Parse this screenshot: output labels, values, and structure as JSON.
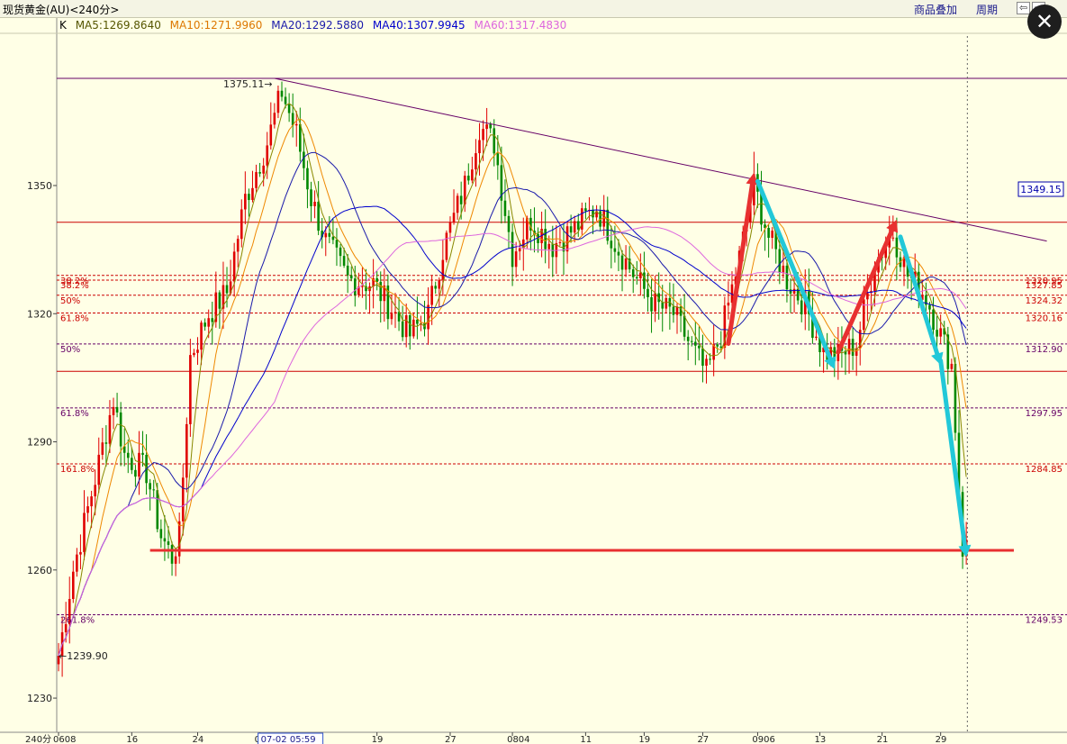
{
  "titlebar": {
    "title": "现货黄金(AU)<240分>",
    "overlay_label": "商品叠加",
    "period_label": "周期",
    "nav_left": "⇦",
    "nav_right": "⇨"
  },
  "close_glyph": "✕",
  "legend": {
    "k": "K",
    "ma5": "MA5:1269.8640",
    "ma10": "MA10:1271.9960",
    "ma20": "MA20:1292.5880",
    "ma40": "MA40:1307.9945",
    "ma60": "MA60:1317.4830"
  },
  "colors": {
    "background": "#ffffe6",
    "up": "#e00000",
    "down": "#008800",
    "ma5": "#888800",
    "ma10": "#ee8800",
    "ma20": "#1a1aaa",
    "ma40": "#0000cc",
    "ma60": "#dd66dd",
    "trendline": "#660066",
    "red_arrow": "#e83030",
    "cyan_arrow": "#22c8d8",
    "price_tag": "#0000aa"
  },
  "chart_data": {
    "type": "candlestick",
    "title": "",
    "ylim": [
      1222,
      1385
    ],
    "y_ticks": [
      1230,
      1260,
      1290,
      1320,
      1350
    ],
    "x_ticks": [
      "0608",
      "16",
      "24",
      "07",
      "19",
      "27",
      "0804",
      "11",
      "19",
      "27",
      "0906",
      "13",
      "21",
      "29"
    ],
    "interval_label": "240分",
    "cursor_time": "07-02 05:59",
    "current_price": "1349.15",
    "max_label": "1375.11",
    "min_label": "1239.90",
    "anchors": [
      [
        0,
        1240
      ],
      [
        4,
        1260
      ],
      [
        11,
        1285
      ],
      [
        15,
        1300
      ],
      [
        18,
        1287
      ],
      [
        24,
        1283
      ],
      [
        28,
        1268
      ],
      [
        31,
        1263
      ],
      [
        33,
        1268
      ],
      [
        36,
        1310
      ],
      [
        41,
        1320
      ],
      [
        46,
        1325
      ],
      [
        51,
        1347
      ],
      [
        57,
        1360
      ],
      [
        61,
        1372
      ],
      [
        65,
        1362
      ],
      [
        69,
        1347
      ],
      [
        73,
        1337
      ],
      [
        79,
        1328
      ],
      [
        86,
        1327
      ],
      [
        91,
        1321
      ],
      [
        96,
        1315
      ],
      [
        101,
        1320
      ],
      [
        105,
        1335
      ],
      [
        111,
        1350
      ],
      [
        115,
        1364
      ],
      [
        119,
        1360
      ],
      [
        124,
        1334
      ],
      [
        129,
        1342
      ],
      [
        135,
        1336
      ],
      [
        141,
        1340
      ],
      [
        147,
        1345
      ],
      [
        153,
        1335
      ],
      [
        158,
        1328
      ],
      [
        163,
        1322
      ],
      [
        168,
        1320
      ],
      [
        173,
        1312
      ],
      [
        177,
        1306
      ],
      [
        181,
        1315
      ],
      [
        186,
        1333
      ],
      [
        190,
        1350
      ],
      [
        194,
        1338
      ],
      [
        199,
        1328
      ],
      [
        204,
        1322
      ],
      [
        209,
        1311
      ],
      [
        213,
        1310
      ],
      [
        218,
        1313
      ],
      [
        223,
        1332
      ],
      [
        228,
        1339
      ],
      [
        232,
        1329
      ],
      [
        237,
        1324
      ],
      [
        241,
        1315
      ],
      [
        244,
        1308
      ],
      [
        247,
        1265
      ],
      [
        249,
        1266
      ]
    ],
    "moving_averages": [
      {
        "name": "MA5",
        "period": 5
      },
      {
        "name": "MA10",
        "period": 10
      },
      {
        "name": "MA20",
        "period": 20
      },
      {
        "name": "MA40",
        "period": 40
      },
      {
        "name": "MA60",
        "period": 60
      }
    ],
    "hlines": [
      {
        "price": 1341.4,
        "style": "solid",
        "color": "#cc0000"
      },
      {
        "price": 1328.95,
        "style": "dashed",
        "color": "#cc0000",
        "left": "38.2%",
        "right": "1328.95"
      },
      {
        "price": 1327.85,
        "style": "dashed",
        "color": "#cc0000",
        "left": "38.2%",
        "right": "1327.85"
      },
      {
        "price": 1324.32,
        "style": "dashed",
        "color": "#cc0000",
        "left": "50%",
        "right": "1324.32"
      },
      {
        "price": 1320.16,
        "style": "dashed",
        "color": "#cc0000",
        "left": "61.8%",
        "right": "1320.16"
      },
      {
        "price": 1312.9,
        "style": "dashed",
        "color": "#660066",
        "left": "50%",
        "right": "1312.90"
      },
      {
        "price": 1306.5,
        "style": "solid",
        "color": "#cc0000"
      },
      {
        "price": 1297.95,
        "style": "dashed",
        "color": "#660066",
        "left": "61.8%",
        "right": "1297.95"
      },
      {
        "price": 1284.85,
        "style": "dashed",
        "color": "#cc0000",
        "left": "161.8%",
        "right": "1284.85"
      },
      {
        "price": 1249.53,
        "style": "dashed",
        "color": "#660066",
        "left": "261.8%",
        "right": "1249.53"
      }
    ],
    "support_line": {
      "price": 1264.6,
      "from": 25,
      "to": 261
    },
    "top_line_price": 1375.1,
    "trendline": {
      "from": [
        59,
        1375.1
      ],
      "to": [
        270,
        1337
      ]
    },
    "arrows": [
      {
        "kind": "red",
        "from": [
          183,
          1313
        ],
        "to": [
          190,
          1353
        ]
      },
      {
        "kind": "cyan",
        "from": [
          191,
          1351
        ],
        "to": [
          212,
          1307
        ]
      },
      {
        "kind": "red",
        "from": [
          213,
          1311
        ],
        "to": [
          229,
          1342
        ]
      },
      {
        "kind": "cyan",
        "from": [
          230,
          1338
        ],
        "to": [
          241,
          1308
        ]
      },
      {
        "kind": "cyan",
        "from": [
          241,
          1309
        ],
        "to": [
          248,
          1263
        ]
      }
    ],
    "last_candle_index": 248
  }
}
